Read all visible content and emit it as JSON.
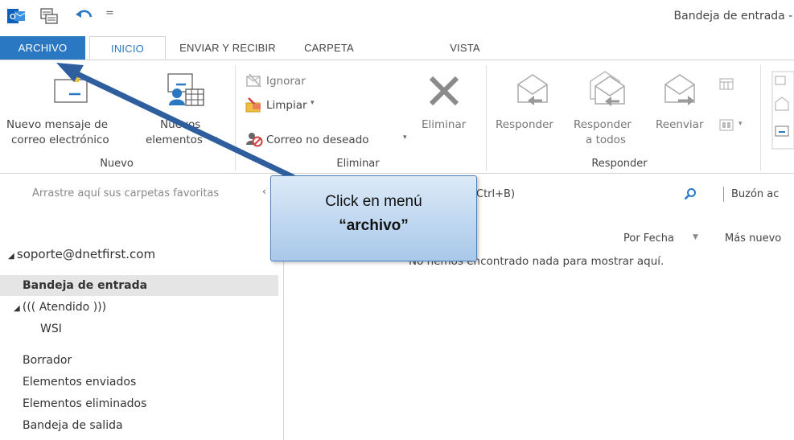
{
  "window": {
    "title": "Bandeja de entrada - s",
    "qa_dropdown": "="
  },
  "tabs": [
    {
      "label": "ARCHIVO"
    },
    {
      "label": "INICIO"
    },
    {
      "label": "ENVIAR Y RECIBIR"
    },
    {
      "label": "CARPETA"
    },
    {
      "label": "VISTA"
    }
  ],
  "ribbon": {
    "nuevo": {
      "new_mail_line1": "Nuevo mensaje de",
      "new_mail_line2": "correo electrónico",
      "new_items_line1": "Nuevos",
      "new_items_line2": "elementos",
      "group_label": "Nuevo"
    },
    "eliminar": {
      "ignorar": "Ignorar",
      "limpiar": "Limpiar",
      "correo_no_deseado": "Correo no deseado",
      "eliminar": "Eliminar",
      "group_label": "Eliminar"
    },
    "responder": {
      "responder": "Responder",
      "responder_todos_line1": "Responder",
      "responder_todos_line2": "a todos",
      "reenviar": "Reenviar",
      "group_label": "Responder"
    }
  },
  "nav": {
    "favorites_hint": "Arrastre aquí sus carpetas favoritas",
    "account": "soporte@dnetfirst.com",
    "folders": [
      {
        "label": "Bandeja de entrada",
        "selected": true
      },
      {
        "label": "((( Atendido )))"
      },
      {
        "label": "WSI"
      },
      {
        "label": "Borrador"
      },
      {
        "label": "Elementos enviados"
      },
      {
        "label": "Elementos eliminados"
      },
      {
        "label": "Bandeja de salida"
      }
    ]
  },
  "content": {
    "search_shortcut": "Ctrl+B)",
    "mailbox_scope": "Buzón ac",
    "sort_by": "Por Fecha",
    "order": "Más nuevo",
    "empty_message": "No hemos encontrado nada para mostrar aquí."
  },
  "callout": {
    "line1": "Click en menú",
    "line2": "“archivo”"
  },
  "colors": {
    "accent": "#2b78c2",
    "callout_border": "#4f81bd",
    "arrow": "#2e5e9e"
  }
}
